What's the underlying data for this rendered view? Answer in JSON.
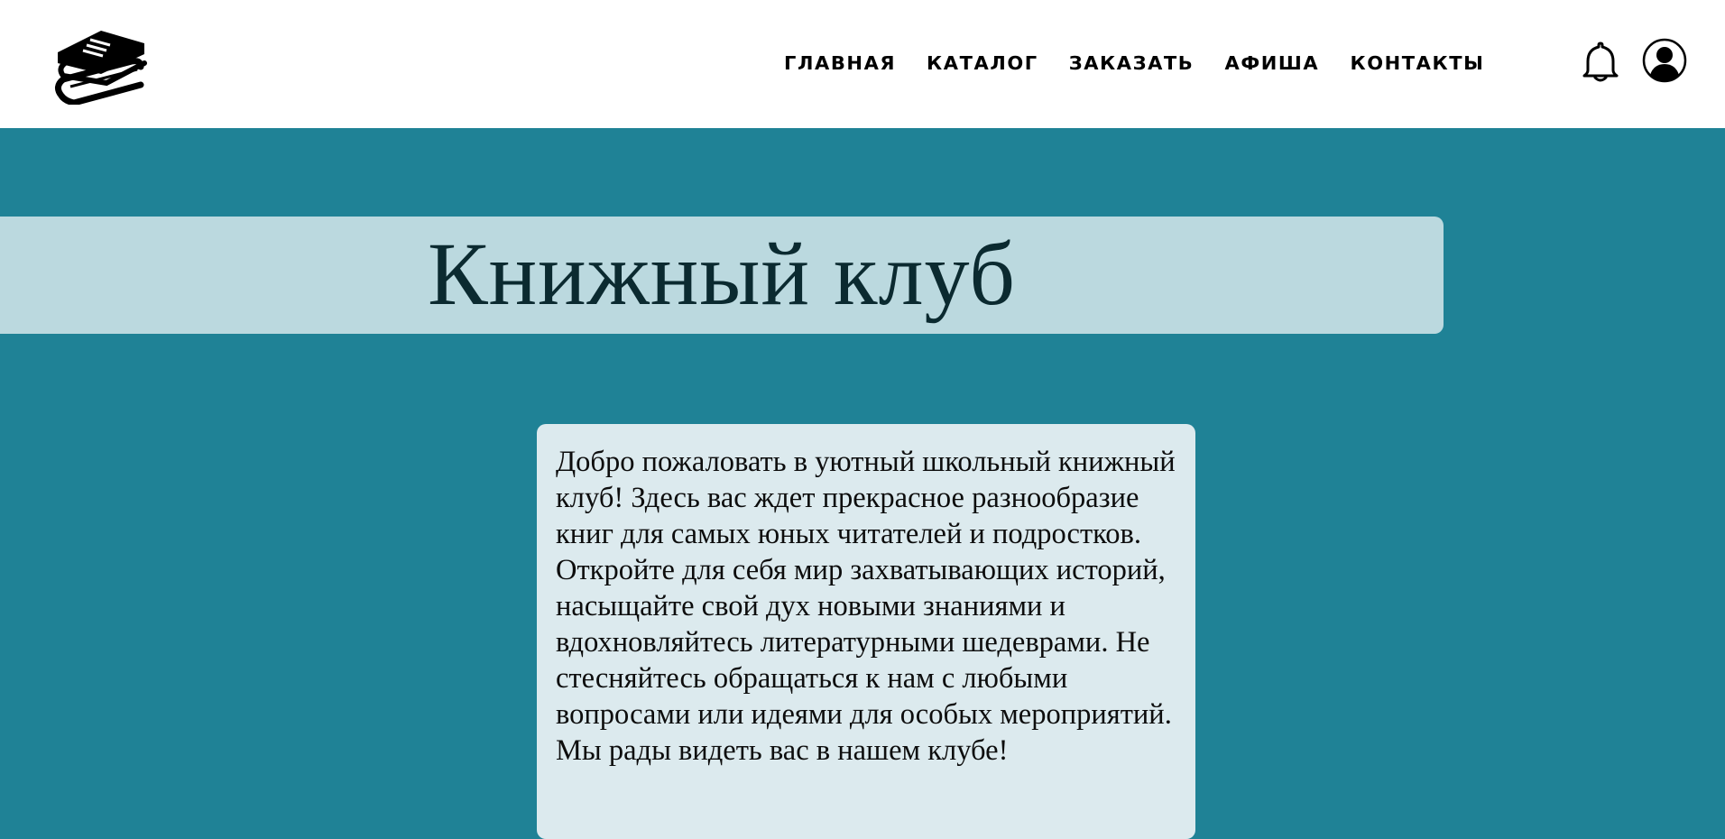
{
  "header": {
    "nav": [
      {
        "label": "ГЛАВНАЯ"
      },
      {
        "label": "КАТАЛОГ"
      },
      {
        "label": "ЗАКАЗАТЬ"
      },
      {
        "label": "АФИША"
      },
      {
        "label": "КОНТАКТЫ"
      }
    ],
    "icons": {
      "logo": "books-stack-icon",
      "notifications": "bell-icon",
      "profile": "user-avatar-icon"
    }
  },
  "hero": {
    "title": "Книжный клуб"
  },
  "intro": {
    "text": "Добро пожаловать в уютный школьный книжный клуб! Здесь вас ждет прекрасное разнообразие книг для самых юных читателей и подростков. Откройте для себя мир захватывающих историй, насыщайте свой дух новыми знаниями и вдохновляйтесь литературными шедеврами. Не стесняйтесь обращаться к нам с любыми вопросами или идеями для особых мероприятий. Мы рады видеть вас в нашем клубе!"
  },
  "colors": {
    "background": "#1f8296",
    "header": "#ffffff",
    "banner": "#bbd9df",
    "card": "#dceaee",
    "title_text": "#0b2a30"
  }
}
